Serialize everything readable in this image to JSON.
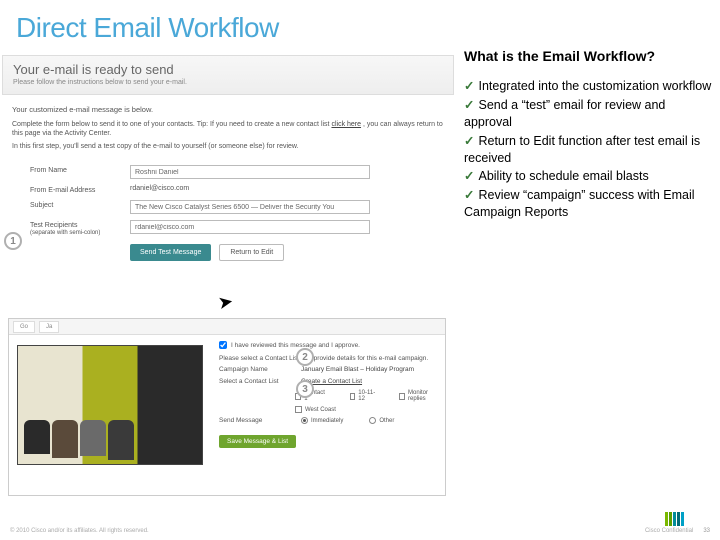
{
  "title": "Direct Email Workflow",
  "banner": {
    "heading": "Your e-mail is ready to send",
    "sub": "Please follow the instructions below to send your e-mail."
  },
  "body": {
    "lead": "Your customized e-mail message is below.",
    "para1_a": "Complete the form below to send it to one of your contacts. Tip: If you need to create a new contact list ",
    "para1_link": "click here",
    "para1_b": ", you can always return to this page via the Activity Center.",
    "para2": "In this first step, you'll send a test copy of the e-mail to yourself (or someone else) for review."
  },
  "form": {
    "from_name_label": "From Name",
    "from_name_value": "Roshni Daniel",
    "from_email_label": "From E-mail Address",
    "from_email_value": "rdaniel@cisco.com",
    "subject_label": "Subject",
    "subject_value": "The New Cisco Catalyst Series 6500 — Deliver the Security You",
    "recipients_label": "Test Recipients",
    "recipients_hint": "(separate with semi-colon)",
    "recipients_value": "rdaniel@cisco.com",
    "send_btn": "Send Test Message",
    "return_btn": "Return to Edit"
  },
  "ss": {
    "tab1": "Go",
    "tab2": "Ja",
    "approve_label": "I have reviewed this message and I approve.",
    "lead": "Please select a Contact List and provide details for this e-mail campaign.",
    "campaign_label": "Campaign Name",
    "campaign_value": "January Email Blast – Holiday Program",
    "select_label": "Select a Contact List",
    "select_value": "Create a Contact List",
    "opt1": "Contact 1",
    "opt2": "10-11-12",
    "opt3": "Monitor replies",
    "opt4": "West Coast",
    "send_label": "Send Message",
    "radio1": "Immediately",
    "radio2": "Other",
    "save_btn": "Save Message & List"
  },
  "callouts": {
    "one": "1",
    "two": "2",
    "three": "3"
  },
  "right": {
    "heading": "What is the Email Workflow?",
    "items": [
      "Integrated into the customization workflow",
      "Send a “test” email for review and approval",
      "Return to Edit function after test email is received",
      "Ability to schedule email blasts",
      "Review “campaign” success with Email Campaign Reports"
    ]
  },
  "footer": {
    "copyright": "© 2010 Cisco and/or its affiliates. All rights reserved.",
    "confidential": "Cisco Confidential",
    "page": "33"
  }
}
